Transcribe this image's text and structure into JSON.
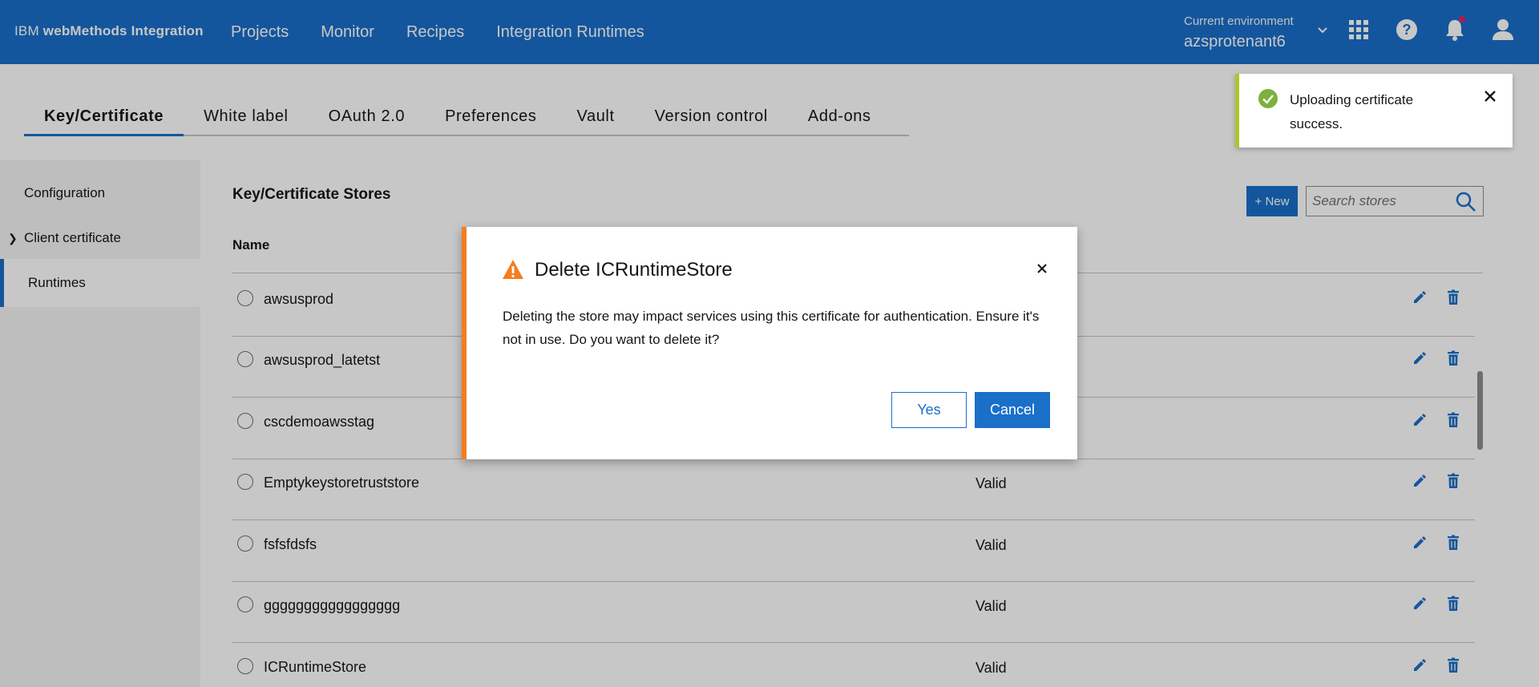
{
  "header": {
    "brand_prefix": "IBM",
    "brand_name": "webMethods Integration",
    "nav": [
      "Projects",
      "Monitor",
      "Recipes",
      "Integration Runtimes"
    ],
    "env_label": "Current environment",
    "env_value": "azsprotenant6",
    "icons": [
      "chevron-down-icon",
      "app-grid-icon",
      "help-icon",
      "notification-icon",
      "user-icon"
    ]
  },
  "tabs": [
    "Key/Certificate",
    "White label",
    "OAuth 2.0",
    "Preferences",
    "Vault",
    "Version control",
    "Add-ons"
  ],
  "active_tab": "Key/Certificate",
  "sidebar": {
    "items": [
      "Configuration",
      "Client certificate",
      "Runtimes"
    ],
    "active": "Runtimes"
  },
  "main": {
    "title": "Key/Certificate Stores",
    "new_button": "+ New",
    "search_placeholder": "Search stores",
    "column_name": "Name",
    "rows": [
      {
        "name": "awsusprod",
        "status": ""
      },
      {
        "name": "awsusprod_latetst",
        "status": ""
      },
      {
        "name": "cscdemoawsstag",
        "status": ""
      },
      {
        "name": "Emptykeystoretruststore",
        "status": "Valid"
      },
      {
        "name": "fsfsfdsfs",
        "status": "Valid"
      },
      {
        "name": "ggggggggggggggggg",
        "status": "Valid"
      },
      {
        "name": "ICRuntimeStore",
        "status": "Valid"
      }
    ]
  },
  "dialog": {
    "title": "Delete ICRuntimeStore",
    "body": "Deleting the store may impact services using this certificate for authentication. Ensure it's not in use. Do you want to delete it?",
    "yes": "Yes",
    "cancel": "Cancel"
  },
  "toast": {
    "message": "Uploading certificate success."
  },
  "colors": {
    "primary": "#1a6fc9",
    "warning": "#f47d20",
    "success": "#a8c62c"
  }
}
